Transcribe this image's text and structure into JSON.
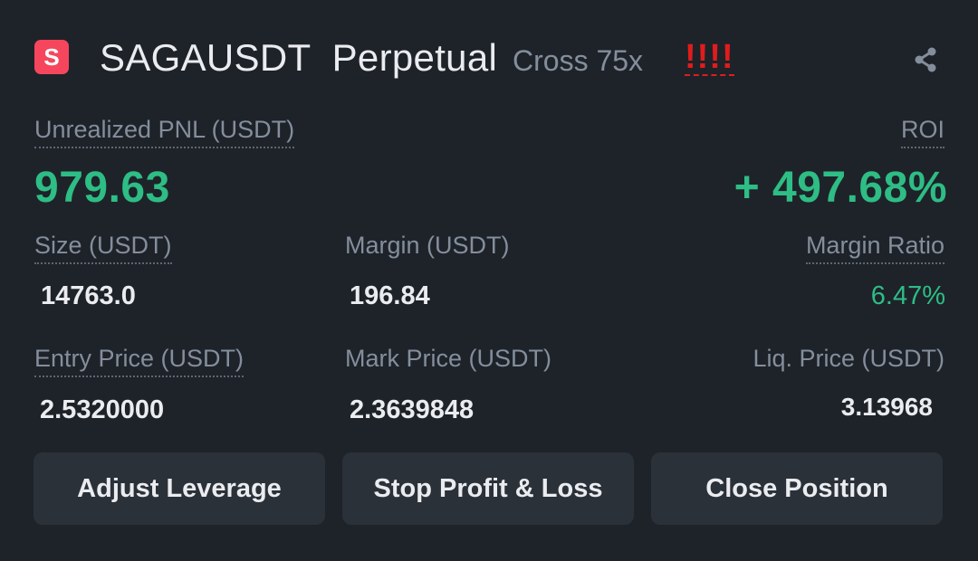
{
  "header": {
    "badge_letter": "S",
    "symbol": "SAGAUSDT  Perpetual",
    "margin_mode": "Cross 75x",
    "risk_indicator": "!!!!",
    "share_icon": "share-icon"
  },
  "pnl": {
    "label": "Unrealized PNL (USDT)",
    "value": "979.63",
    "roi_label": "ROI",
    "roi_value": "+ 497.68%"
  },
  "stats": {
    "size_label": "Size (USDT)",
    "size_value": "14763.0",
    "margin_label": "Margin (USDT)",
    "margin_value": "196.84",
    "margin_ratio_label": "Margin Ratio",
    "margin_ratio_value": "6.47%",
    "entry_label": "Entry Price (USDT)",
    "entry_value": "2.5320000",
    "mark_label": "Mark Price (USDT)",
    "mark_value": "2.3639848",
    "liq_label": "Liq. Price (USDT)",
    "liq_value": "3.13968"
  },
  "actions": {
    "adjust_leverage": "Adjust Leverage",
    "stop_profit_loss": "Stop Profit & Loss",
    "close_position": "Close Position"
  },
  "colors": {
    "background": "#1e2329",
    "positive": "#2ebd85",
    "negative": "#f6465d",
    "warning": "#e01c1c",
    "button": "#2b3139"
  }
}
